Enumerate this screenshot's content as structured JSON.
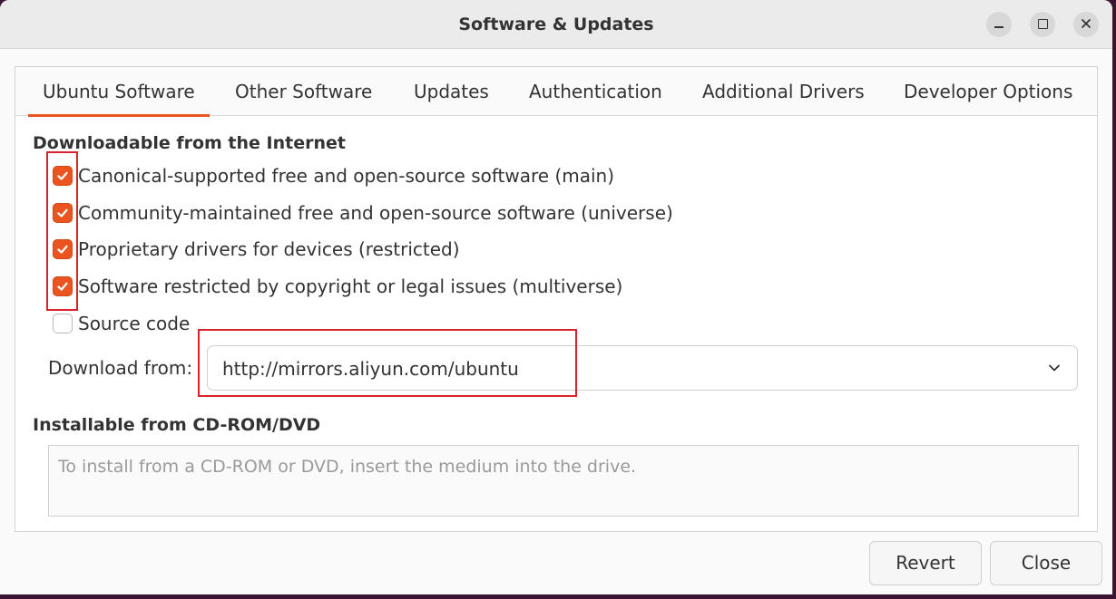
{
  "window": {
    "title": "Software & Updates",
    "controls": [
      "minimize",
      "maximize",
      "close"
    ]
  },
  "tabs": [
    {
      "label": "Ubuntu Software",
      "active": true
    },
    {
      "label": "Other Software",
      "active": false
    },
    {
      "label": "Updates",
      "active": false
    },
    {
      "label": "Authentication",
      "active": false
    },
    {
      "label": "Additional Drivers",
      "active": false
    },
    {
      "label": "Developer Options",
      "active": false
    }
  ],
  "internet": {
    "heading": "Downloadable from the Internet",
    "options": [
      {
        "label": "Canonical-supported free and open-source software (main)",
        "checked": true
      },
      {
        "label": "Community-maintained free and open-source software (universe)",
        "checked": true
      },
      {
        "label": "Proprietary drivers for devices (restricted)",
        "checked": true
      },
      {
        "label": "Software restricted by copyright or legal issues (multiverse)",
        "checked": true
      },
      {
        "label": "Source code",
        "checked": false
      }
    ],
    "download_from_label": "Download from:",
    "download_from_value": "http://mirrors.aliyun.com/ubuntu"
  },
  "cdrom": {
    "heading": "Installable from CD-ROM/DVD",
    "placeholder": "To install from a CD-ROM or DVD, insert the medium into the drive."
  },
  "buttons": {
    "revert": "Revert",
    "close": "Close"
  },
  "colors": {
    "accent": "#e95420",
    "annotation": "#d8232a"
  },
  "icons": {
    "checkmark": "check-icon",
    "dropdown": "chevron-down-icon"
  }
}
